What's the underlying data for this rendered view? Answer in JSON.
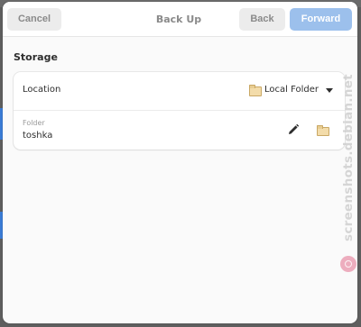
{
  "header": {
    "cancel_label": "Cancel",
    "title": "Back Up",
    "back_label": "Back",
    "forward_label": "Forward"
  },
  "storage": {
    "section_title": "Storage",
    "location": {
      "label": "Location",
      "value": "Local Folder",
      "icon": "folder-icon"
    },
    "folder": {
      "caption": "Folder",
      "value": "toshka",
      "edit_icon": "pencil-icon",
      "browse_icon": "folder-icon"
    }
  },
  "watermark": {
    "text": "screenshots.debian.net"
  },
  "colors": {
    "forward_button_bg": "#9cc0ec",
    "dialog_bg": "#fafafa",
    "card_bg": "#ffffff",
    "folder_icon": "#f3dcaa"
  }
}
